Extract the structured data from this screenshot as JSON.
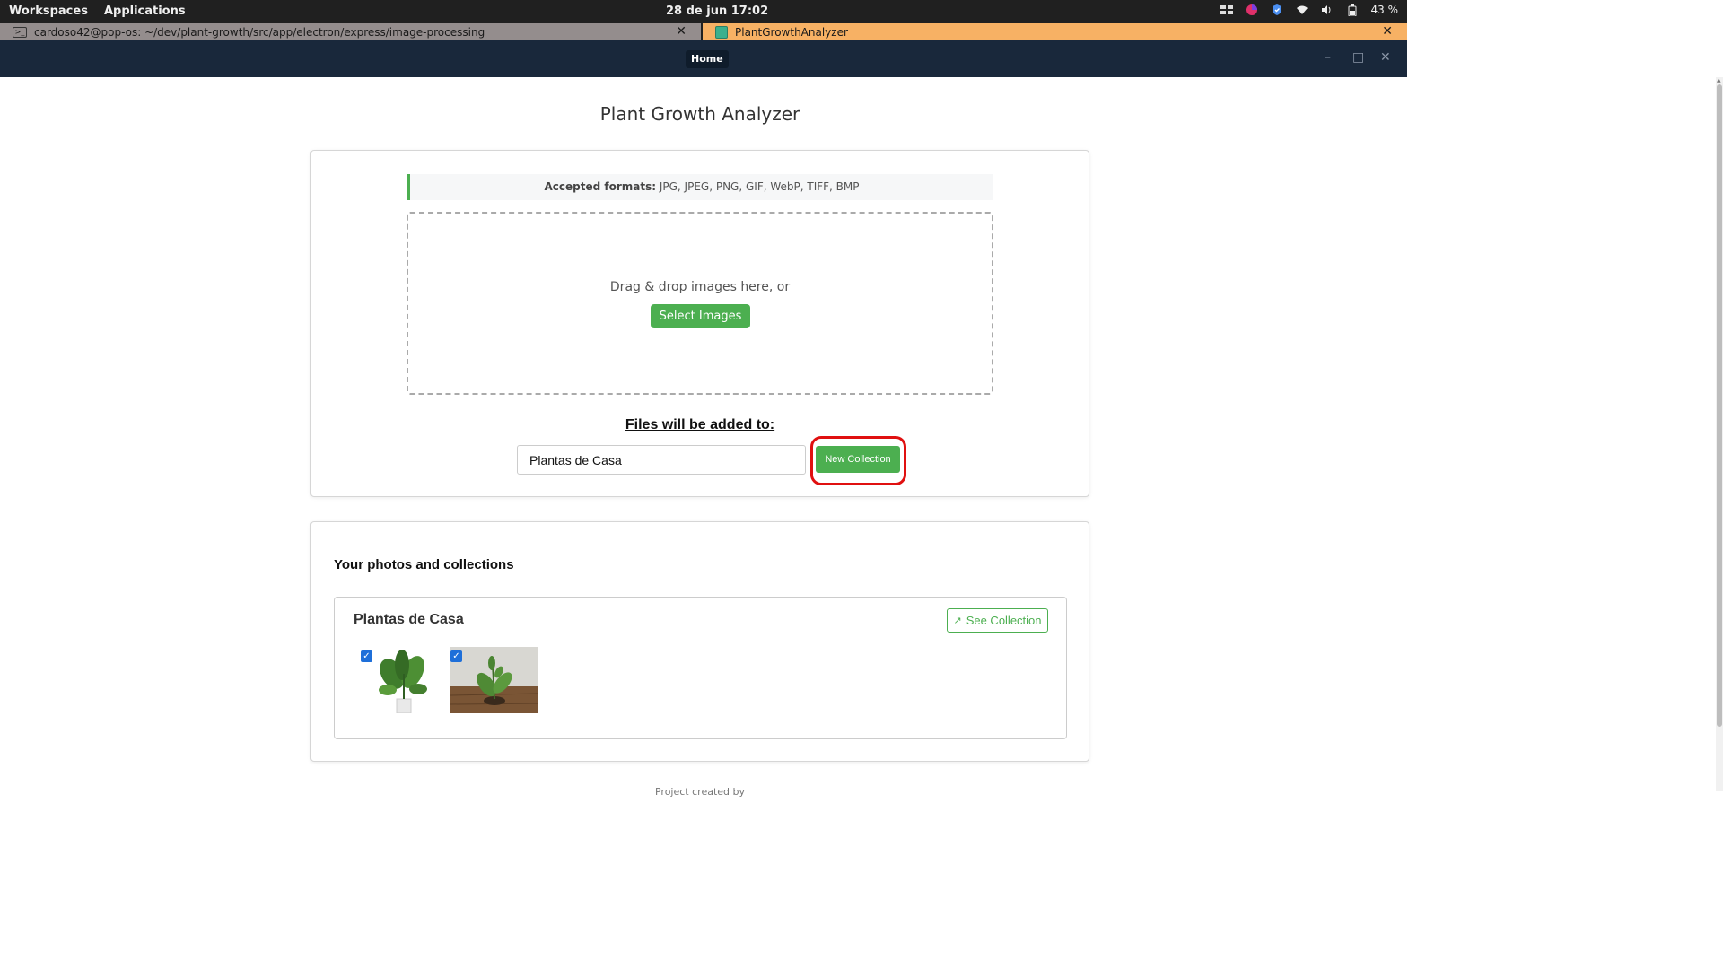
{
  "os": {
    "workspaces": "Workspaces",
    "applications": "Applications",
    "clock": "28 de jun  17:02",
    "battery": "43 %"
  },
  "tabs": {
    "terminal": "cardoso42@pop-os: ~/dev/plant-growth/src/app/electron/express/image-processing",
    "app": "PlantGrowthAnalyzer"
  },
  "header": {
    "home": "Home"
  },
  "page": {
    "title": "Plant Growth Analyzer"
  },
  "upload": {
    "formats_label": "Accepted formats:",
    "formats_value": " JPG, JPEG, PNG, GIF, WebP, TIFF, BMP",
    "drop_text": "Drag & drop images here, or",
    "select_button": "Select Images",
    "added_to": "Files will be added to:",
    "collection_value": "Plantas de Casa",
    "new_collection_button": "New Collection"
  },
  "photos": {
    "title": "Your photos and collections",
    "collections": [
      {
        "name": "Plantas de Casa",
        "see_button": "See Collection",
        "images": [
          {
            "checked": true,
            "icon": "potted-plant-white-pot"
          },
          {
            "checked": true,
            "icon": "plant-on-wooden-table"
          }
        ]
      }
    ]
  },
  "footer": {
    "text": "Project created by"
  },
  "colors": {
    "accent_green": "#4caf50",
    "highlight_red": "#e01010",
    "header_bg": "#19283b",
    "app_tab_bg": "#f7b164"
  }
}
